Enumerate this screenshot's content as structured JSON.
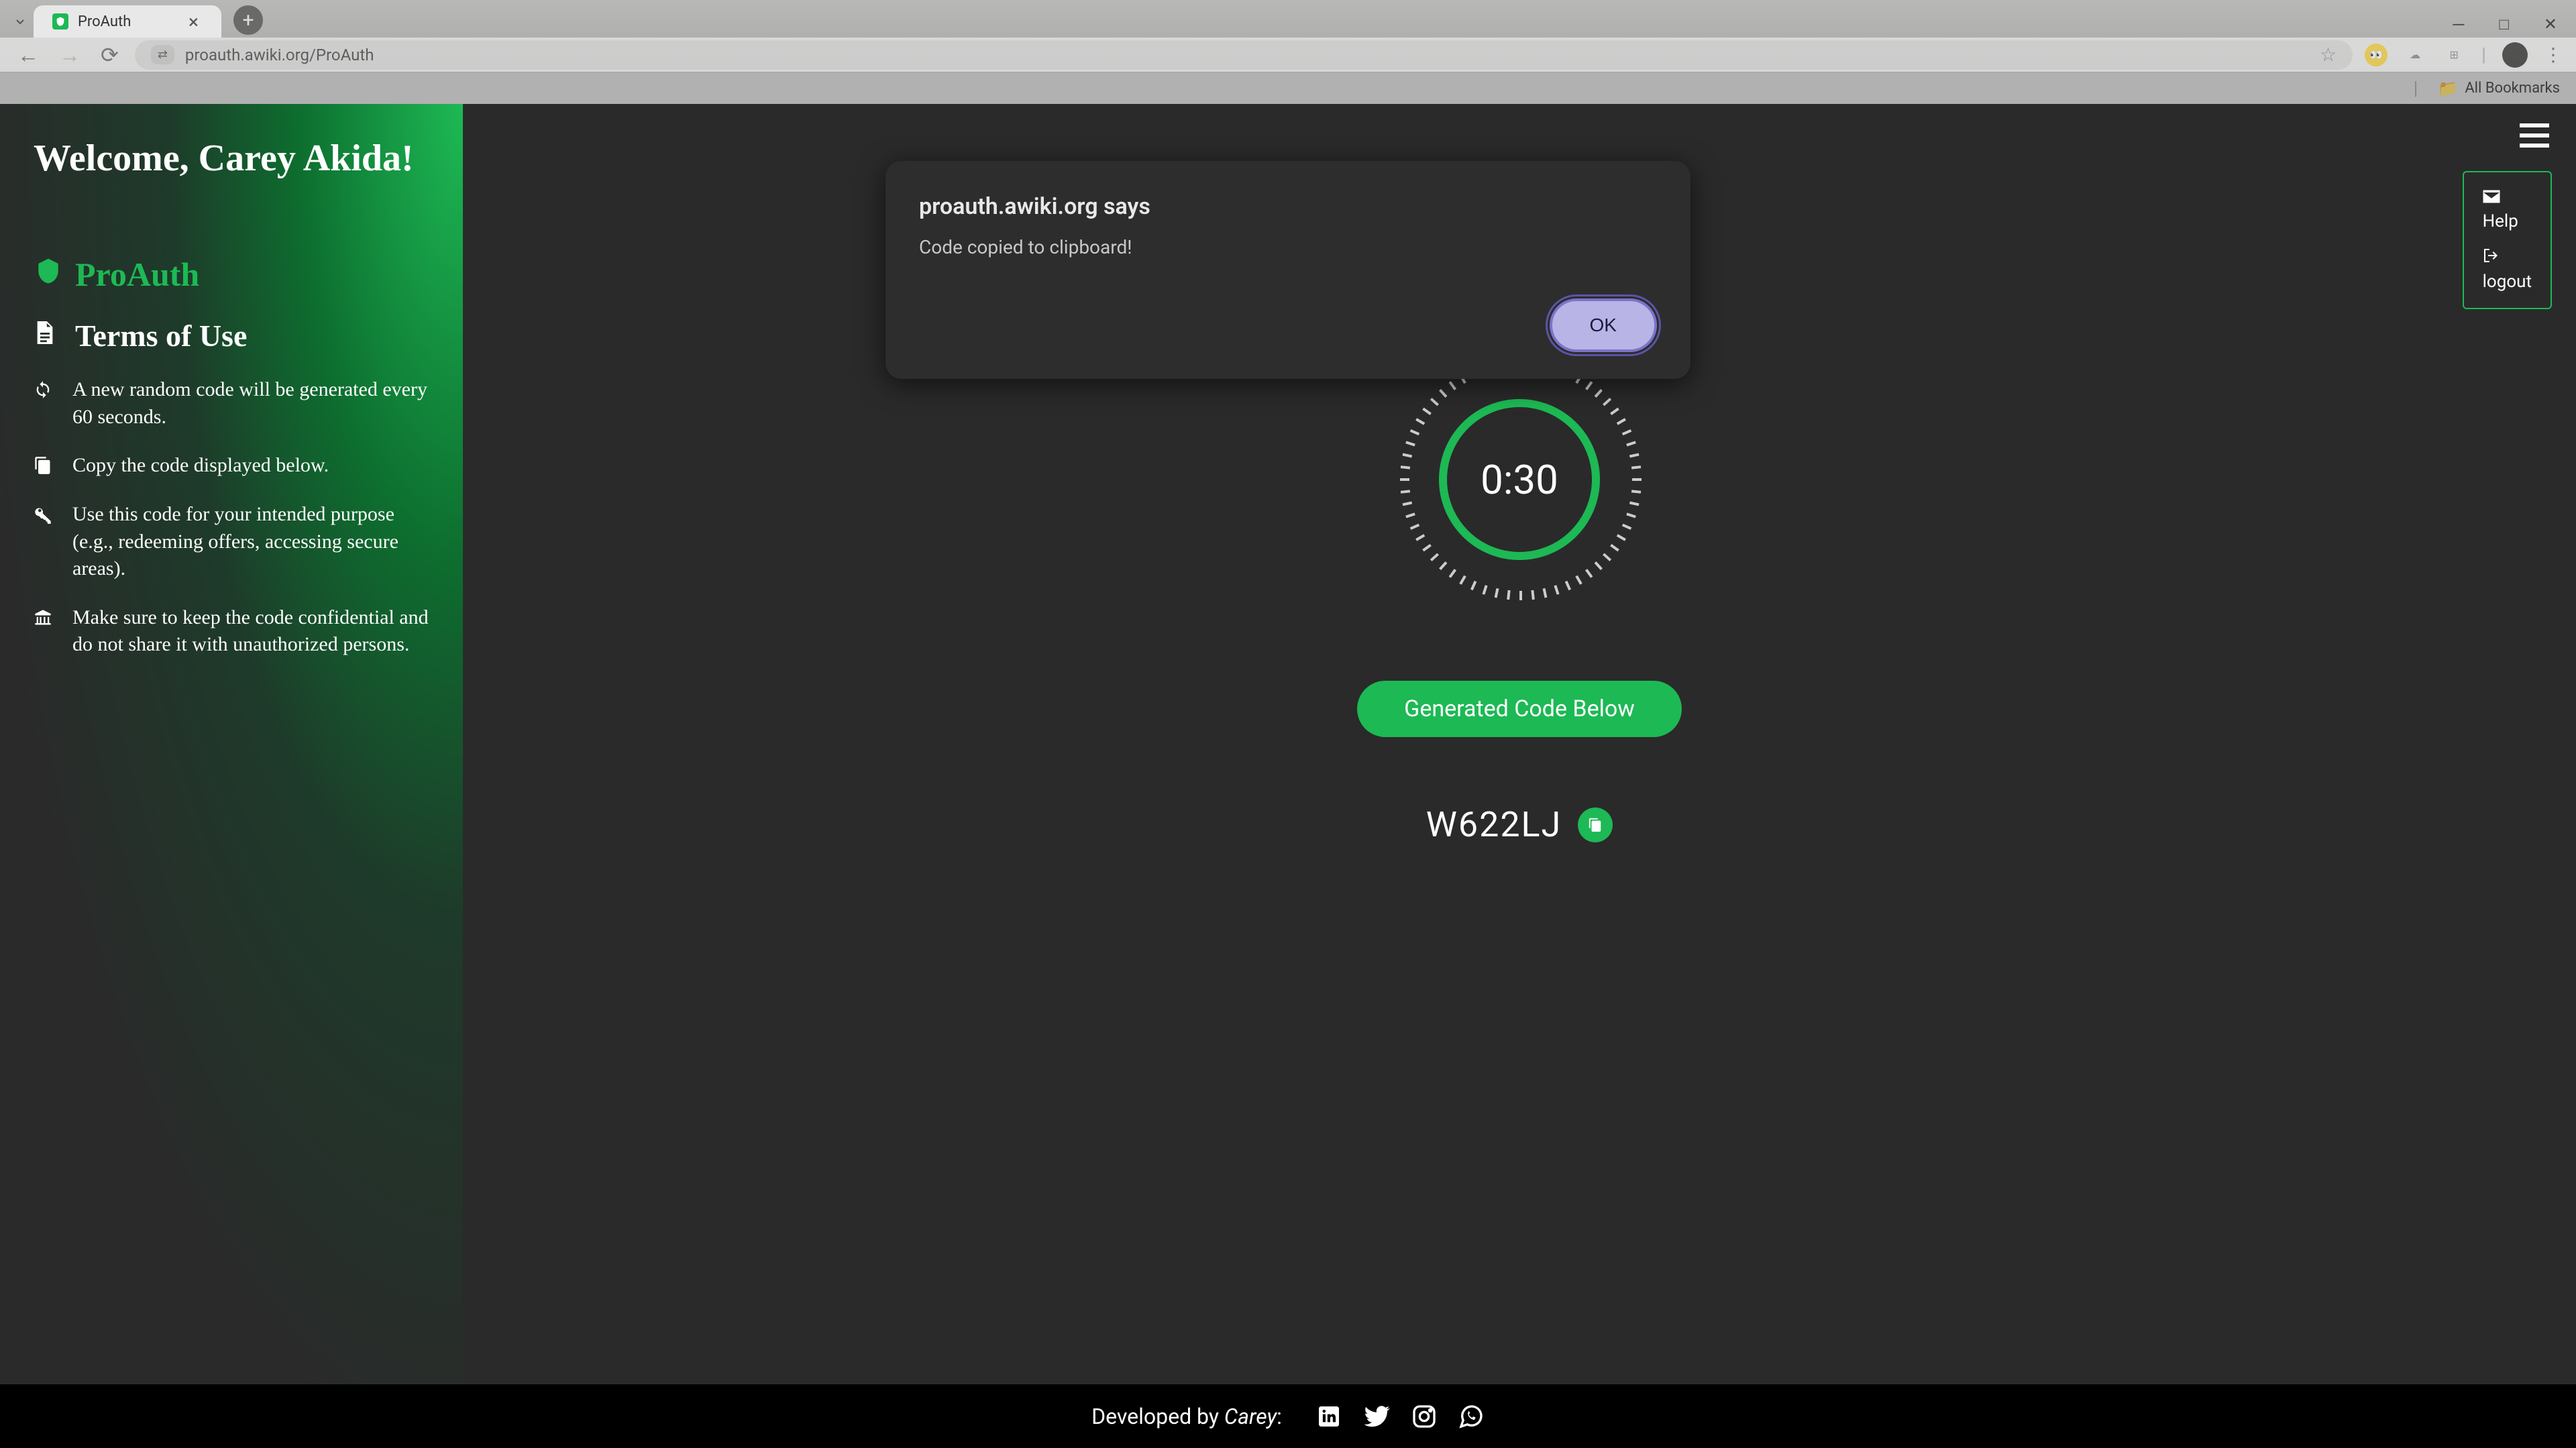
{
  "browser": {
    "tab_title": "ProAuth",
    "url": "proauth.awiki.org/ProAuth",
    "bookmarks_label": "All Bookmarks"
  },
  "alert": {
    "title": "proauth.awiki.org says",
    "message": "Code copied to clipboard!",
    "ok_label": "OK"
  },
  "sidebar": {
    "welcome": "Welcome, Carey Akida!",
    "app_name": "ProAuth",
    "terms_heading": "Terms of Use",
    "terms": [
      "A new random code will be generated every 60 seconds.",
      "Copy the code displayed below.",
      "Use this code for your intended purpose (e.g., redeeming offers, accessing secure areas).",
      "Make sure to keep the code confidential and do not share it with unauthorized persons."
    ]
  },
  "menu": {
    "help_label": "Help",
    "logout_label": "logout"
  },
  "main": {
    "timer_value": "0:30",
    "pill_label": "Generated Code Below",
    "generated_code": "W622LJ"
  },
  "footer": {
    "developed_by": "Developed by ",
    "author": "Carey",
    "suffix": ":"
  }
}
